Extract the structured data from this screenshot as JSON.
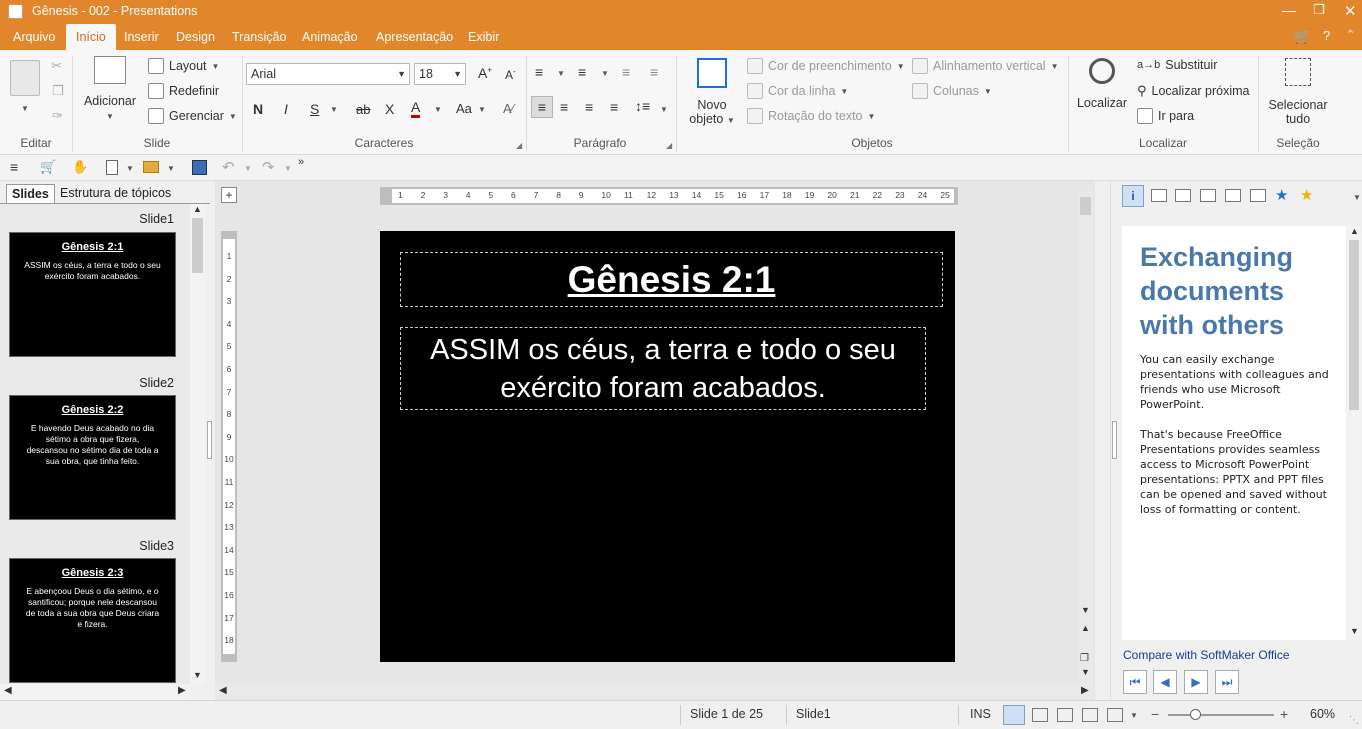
{
  "window": {
    "title": "Gênesis - 002 - Presentations"
  },
  "menu": {
    "tabs": [
      "Arquivo",
      "Início",
      "Inserir",
      "Design",
      "Transição",
      "Animação",
      "Apresentação",
      "Exibir"
    ]
  },
  "ribbon": {
    "editar": {
      "label": "Editar"
    },
    "slide": {
      "label": "Slide",
      "adicionar": "Adicionar",
      "layout": "Layout",
      "redefinir": "Redefinir",
      "gerenciar": "Gerenciar"
    },
    "caracteres": {
      "label": "Caracteres",
      "font": "Arial",
      "size": "18"
    },
    "paragrafo": {
      "label": "Parágrafo"
    },
    "objetos": {
      "label": "Objetos",
      "novo_objeto_l1": "Novo",
      "novo_objeto_l2": "objeto",
      "cor_preenchimento": "Cor de preenchimento",
      "cor_linha": "Cor da linha",
      "rotacao": "Rotação do texto",
      "alinhamento": "Alinhamento vertical",
      "colunas": "Colunas"
    },
    "localizar": {
      "label": "Localizar",
      "localizar": "Localizar",
      "substituir": "Substituir",
      "localizar_proxima": "Localizar próxima",
      "ir_para": "Ir para"
    },
    "selecao": {
      "label": "Seleção",
      "selecionar_l1": "Selecionar",
      "selecionar_l2": "tudo"
    }
  },
  "leftpane": {
    "tabs": [
      "Slides",
      "Estrutura de tópicos"
    ],
    "slides": [
      {
        "label": "Slide1",
        "title": "Gênesis 2:1",
        "body": "ASSIM os céus, a terra e todo o seu exército foram acabados."
      },
      {
        "label": "Slide2",
        "title": "Gênesis 2:2",
        "body": "E havendo Deus acabado no dia sétimo a obra que fizera, descansou no sétimo dia de toda a sua obra, que tinha feito."
      },
      {
        "label": "Slide3",
        "title": "Gênesis 2:3",
        "body": "E abençoou Deus o dia sétimo, e o santificou; porque nele descansou de toda a sua obra que Deus criara e fizera."
      }
    ]
  },
  "slide": {
    "title": "Gênesis 2:1",
    "body": "ASSIM os céus, a terra e todo o seu exército foram acabados."
  },
  "ruler": {
    "h": [
      "1",
      "2",
      "3",
      "4",
      "5",
      "6",
      "7",
      "8",
      "9",
      "10",
      "11",
      "12",
      "13",
      "14",
      "15",
      "16",
      "17",
      "18",
      "19",
      "20",
      "21",
      "22",
      "23",
      "24",
      "25"
    ],
    "v": [
      "1",
      "2",
      "3",
      "4",
      "5",
      "6",
      "7",
      "8",
      "9",
      "10",
      "11",
      "12",
      "13",
      "14",
      "15",
      "16",
      "17",
      "18"
    ]
  },
  "sidebar": {
    "heading": "Exchanging documents with others",
    "p1": "You can easily exchange presentations with colleagues and friends who use Microsoft PowerPoint.",
    "p2": "That's because FreeOffice Presentations provides seamless access to Microsoft PowerPoint presentations: PPTX and PPT files can be opened and saved without loss of formatting or content.",
    "link": "Compare with SoftMaker Office"
  },
  "status": {
    "slide_count": "Slide 1 de 25",
    "slide_name": "Slide1",
    "mode": "INS",
    "zoom": "60%"
  },
  "colors": {
    "accent": "#e1862a",
    "sidebar_heading": "#4a78a8",
    "link": "#1a3c8c"
  }
}
